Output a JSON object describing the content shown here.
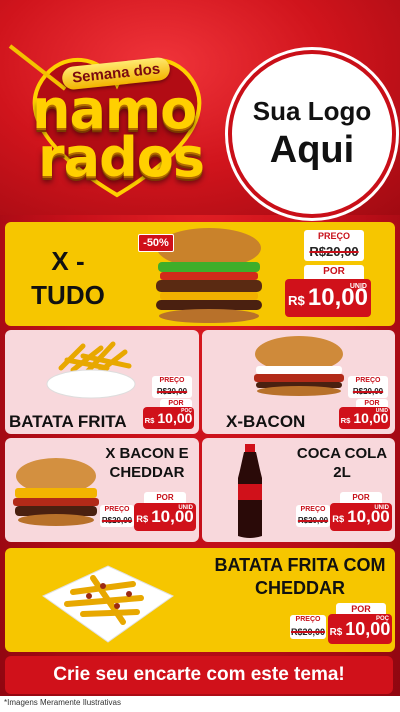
{
  "header": {
    "brand_small": "Semana dos",
    "brand_line1": "namo",
    "brand_line2": "rados",
    "logo_line1": "Sua Logo",
    "logo_line2": "Aqui"
  },
  "products": [
    {
      "name": "X - TUDO",
      "discount": "-50%",
      "preco_label": "PREÇO",
      "old_price": "R$20,00",
      "por_label": "POR",
      "currency": "R$",
      "new_price": "10,00",
      "unit": "UNID"
    },
    {
      "name": "BATATA FRITA",
      "preco_label": "PREÇO",
      "old_price": "R$20,00",
      "por_label": "POR",
      "currency": "R$",
      "new_price": "10,00",
      "unit": "POÇ"
    },
    {
      "name": "X-BACON",
      "preco_label": "PREÇO",
      "old_price": "R$20,00",
      "por_label": "POR",
      "currency": "R$",
      "new_price": "10,00",
      "unit": "UNID"
    },
    {
      "name": "X BACON E CHEDDAR",
      "preco_label": "PREÇO",
      "old_price": "R$20,00",
      "por_label": "POR",
      "currency": "R$",
      "new_price": "10,00",
      "unit": "UNID"
    },
    {
      "name": "COCA COLA 2L",
      "preco_label": "PREÇO",
      "old_price": "R$20,00",
      "por_label": "POR",
      "currency": "R$",
      "new_price": "10,00",
      "unit": "UNID"
    },
    {
      "name": "BATATA FRITA COM CHEDDAR",
      "preco_label": "PREÇO",
      "old_price": "R$20,00",
      "por_label": "POR",
      "currency": "R$",
      "new_price": "10,00",
      "unit": "POÇ"
    }
  ],
  "cta": "Crie seu encarte com este tema!",
  "footnote": "*Imagens Meramente Ilustrativas",
  "colors": {
    "red": "#d0111a",
    "yellow": "#f6c600",
    "pink": "#f8d8dc"
  }
}
